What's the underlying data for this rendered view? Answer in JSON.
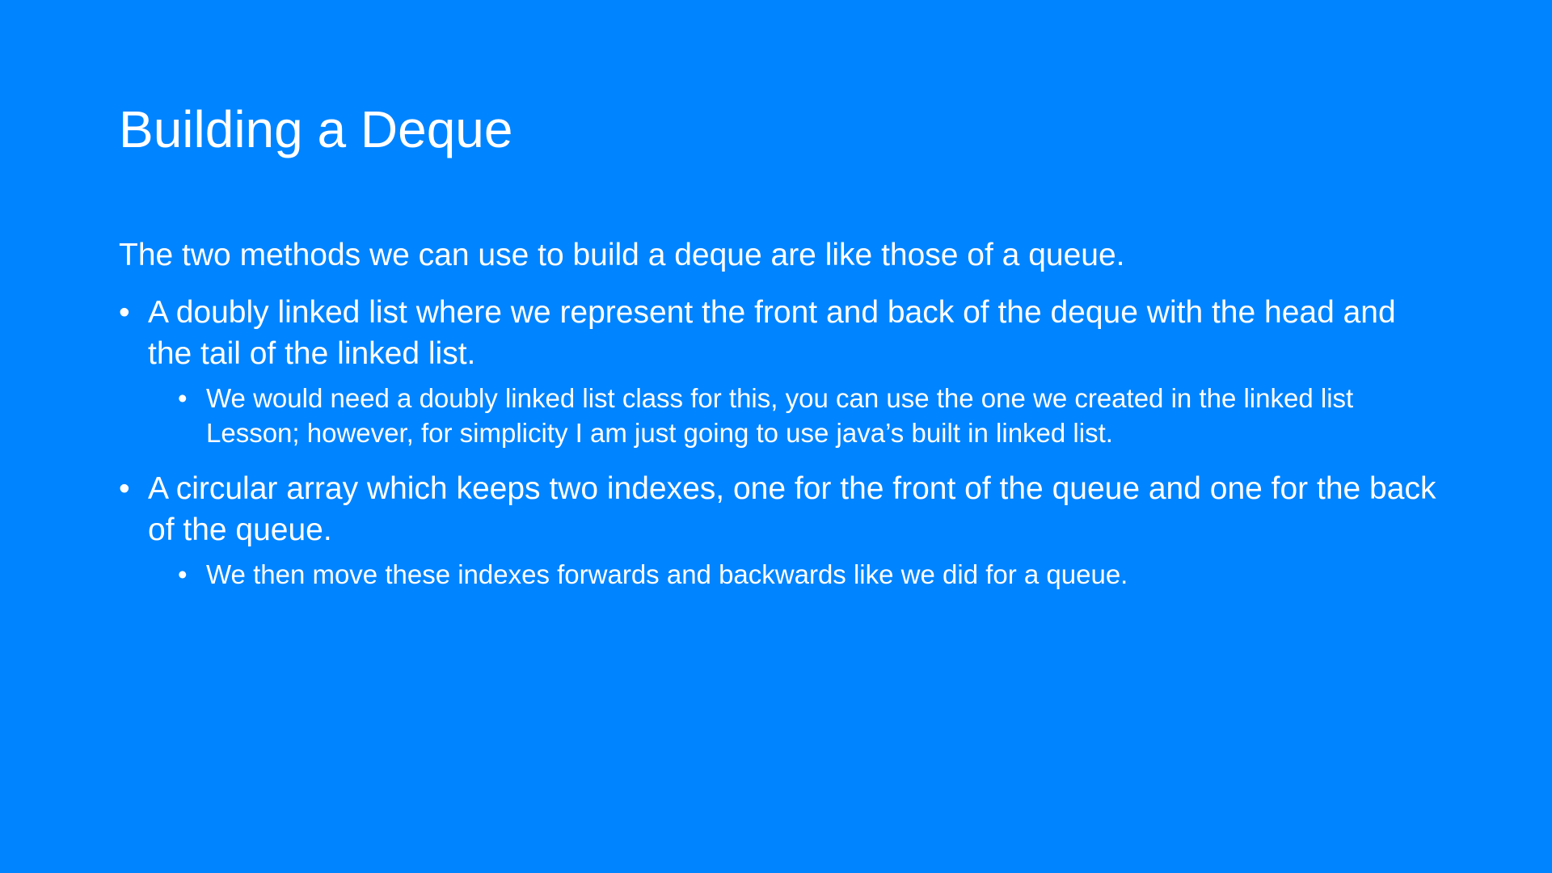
{
  "slide": {
    "title": "Building a Deque",
    "intro": "The two methods we can use to build a deque are like those of a queue.",
    "bullet_char": "•",
    "items": [
      {
        "text": "A doubly linked list where we represent the front and back of the deque with the head and the tail of the linked list.",
        "sub": "We would need a doubly linked list class for this, you can use the one we created in the linked list Lesson; however, for simplicity I am just going to use java’s built in linked list."
      },
      {
        "text": "A circular array which keeps two indexes, one for the front of the queue and one for the back of the queue.",
        "sub": "We then move these indexes forwards and backwards like we did for a queue."
      }
    ]
  },
  "colors": {
    "background": "#0084FF",
    "text": "#FFFFFF"
  }
}
